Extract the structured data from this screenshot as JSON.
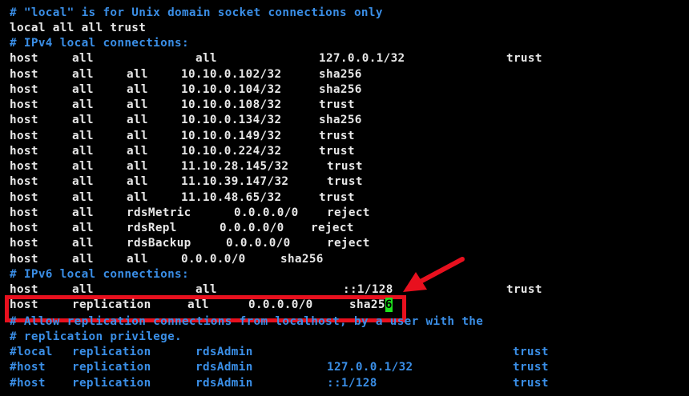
{
  "window": {
    "title": ""
  },
  "colors": {
    "background": "#000000",
    "comment": "#3a8ee6",
    "text": "#e8e8e8",
    "cursor": "#1ee31e",
    "highlight_border": "#e8101e",
    "arrow": "#e8101e"
  },
  "lines": [
    {
      "kind": "comment",
      "cols": [
        "# \"local\" is for Unix domain socket connections only"
      ]
    },
    {
      "kind": "text",
      "cols": [
        "local all all trust"
      ]
    },
    {
      "kind": "comment",
      "cols": [
        "# IPv4 local connections:"
      ]
    },
    {
      "kind": "text",
      "cols": [
        "host",
        "all",
        "all",
        "127.0.0.1/32",
        "trust"
      ]
    },
    {
      "kind": "text",
      "cols": [
        "host",
        "all",
        "all",
        "10.10.0.102/32",
        "sha256"
      ]
    },
    {
      "kind": "text",
      "cols": [
        "host",
        "all",
        "all",
        "10.10.0.104/32",
        "sha256"
      ]
    },
    {
      "kind": "text",
      "cols": [
        "host",
        "all",
        "all",
        "10.10.0.108/32",
        "trust"
      ]
    },
    {
      "kind": "text",
      "cols": [
        "host",
        "all",
        "all",
        "10.10.0.134/32",
        "sha256"
      ]
    },
    {
      "kind": "text",
      "cols": [
        "host",
        "all",
        "all",
        "10.10.0.149/32",
        "trust"
      ]
    },
    {
      "kind": "text",
      "cols": [
        "host",
        "all",
        "all",
        "10.10.0.224/32",
        "trust"
      ]
    },
    {
      "kind": "text",
      "cols": [
        "host",
        "all",
        "all",
        "11.10.28.145/32",
        "trust"
      ]
    },
    {
      "kind": "text",
      "cols": [
        "host",
        "all",
        "all",
        "11.10.39.147/32",
        "trust"
      ]
    },
    {
      "kind": "text",
      "cols": [
        "host",
        "all",
        "all",
        "11.10.48.65/32",
        "trust"
      ]
    },
    {
      "kind": "text",
      "cols": [
        "host",
        "all",
        "rdsMetric",
        "0.0.0.0/0",
        "reject"
      ]
    },
    {
      "kind": "text",
      "cols": [
        "host",
        "all",
        "rdsRepl",
        "0.0.0.0/0",
        "reject"
      ]
    },
    {
      "kind": "text",
      "cols": [
        "host",
        "all",
        "rdsBackup",
        "0.0.0.0/0",
        "reject"
      ]
    },
    {
      "kind": "text",
      "cols": [
        "host",
        "all",
        "all",
        "0.0.0.0/0",
        "sha256"
      ]
    },
    {
      "kind": "comment",
      "cols": [
        "# IPv6 local connections:"
      ]
    },
    {
      "kind": "text",
      "cols": [
        "host",
        "all",
        "all",
        "::1/128",
        "trust"
      ]
    },
    {
      "kind": "text",
      "cols": [
        "host",
        "replication",
        "all",
        "0.0.0.0/0",
        "sha25"
      ],
      "cursor_char": "6"
    },
    {
      "kind": "comment",
      "cols": [
        "# Allow replication connections from localhost, by a user with the"
      ]
    },
    {
      "kind": "comment",
      "cols": [
        "# replication privilege."
      ]
    },
    {
      "kind": "comment",
      "cols": [
        "#local",
        "replication",
        "rdsAdmin",
        "trust"
      ]
    },
    {
      "kind": "comment",
      "cols": [
        "#host",
        "replication",
        "rdsAdmin",
        "127.0.0.1/32",
        "trust"
      ]
    },
    {
      "kind": "comment",
      "cols": [
        "#host",
        "replication",
        "rdsAdmin",
        "::1/128",
        "trust"
      ]
    }
  ]
}
